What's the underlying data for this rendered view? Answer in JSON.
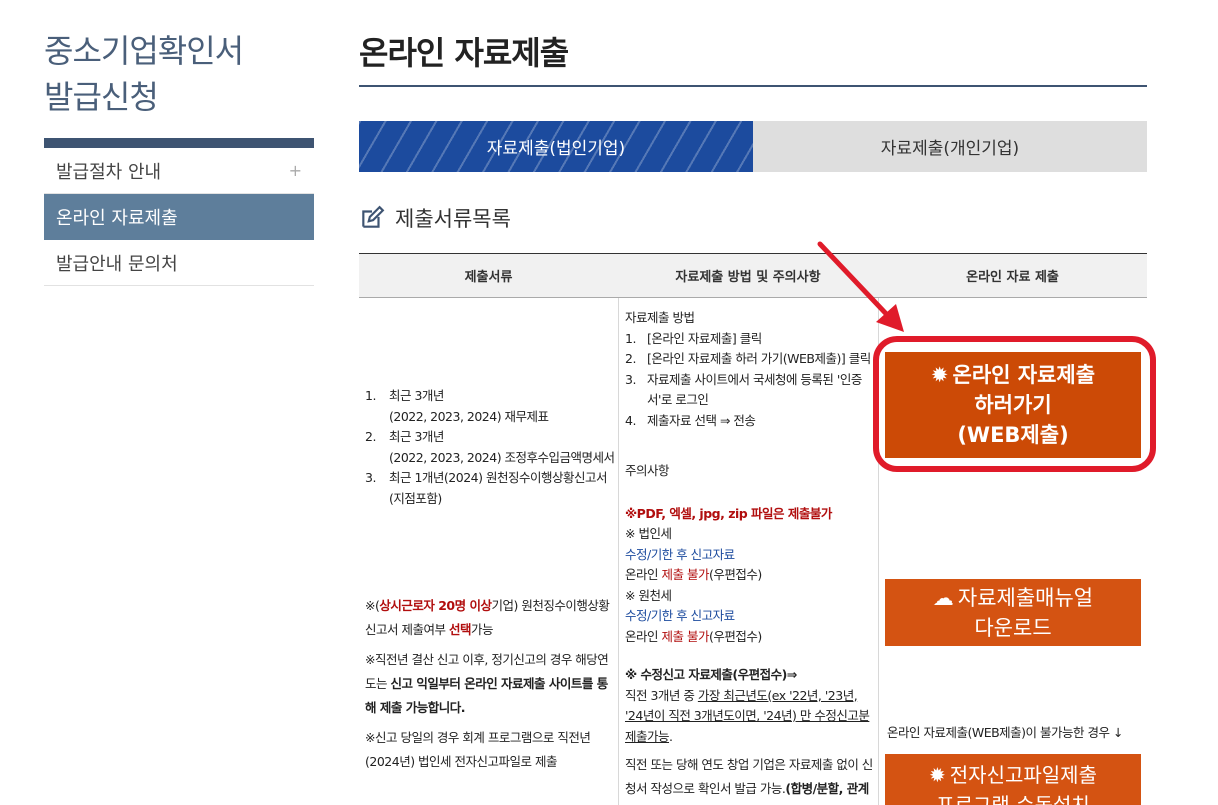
{
  "sidebar": {
    "title_line1": "중소기업확인서",
    "title_line2": "발급신청",
    "items": [
      {
        "label": "발급절차 안내",
        "plus": "+"
      },
      {
        "label": "온라인 자료제출"
      },
      {
        "label": "발급안내 문의처"
      }
    ]
  },
  "main": {
    "title": "온라인 자료제출",
    "tabs": [
      {
        "label": "자료제출(법인기업)"
      },
      {
        "label": "자료제출(개인기업)"
      }
    ],
    "section_title": "제출서류목록",
    "table": {
      "headers": [
        "제출서류",
        "자료제출 방법 및 주의사항",
        "온라인 자료 제출"
      ],
      "docs": [
        {
          "num": "1.",
          "line1": "최근 3개년",
          "line2": "(2022, 2023, 2024) 재무제표"
        },
        {
          "num": "2.",
          "line1": "최근 3개년",
          "line2": "(2022, 2023, 2024) 조정후수입금액명세서"
        },
        {
          "num": "3.",
          "line1": "최근 1개년(2024) 원천징수이행상황신고서",
          "line2": "(지점포함)"
        }
      ],
      "note1_pre": "※(",
      "note1_red": "상시근로자 20명 이상",
      "note1_mid": "기업) 원천징수이행상황신고서 제출여부 ",
      "note1_red2": "선택",
      "note1_post": "가능",
      "note2_pre": "※직전년 결산 신고 이후, 정기신고의 경우 해당연도는 ",
      "note2_bold": "신고 익일부터 온라인 자료제출 사이트를 통해 제출 가능합니다.",
      "note3": "※신고 당일의 경우 회계 프로그램으로 직전년(2024년) 법인세 전자신고파일로 제출",
      "method_title": "자료제출 방법",
      "steps": [
        {
          "num": "1.",
          "text": "[온라인 자료제출] 클릭"
        },
        {
          "num": "2.",
          "text": "[온라인 자료제출 하러 가기(WEB제출)] 클릭"
        },
        {
          "num": "3.",
          "text": "자료제출 사이트에서 국세청에 등록된 '인증서'로 로그인"
        },
        {
          "num": "4.",
          "text": "제출자료 선택 ⇒ 전송"
        }
      ],
      "caution_title": "주의사항",
      "caution_red": "※PDF, 엑셀, jpg, zip 파일은 제출불가",
      "corp_tax": "※ 법인세",
      "corp_amend": "수정/기한 후 신고자료",
      "corp_online_pre": "온라인 ",
      "corp_online_red": "제출 불가",
      "corp_online_post": "(우편접수)",
      "wh_tax": "※ 원천세",
      "wh_amend": "수정/기한 후 신고자료",
      "wh_online_pre": "온라인 ",
      "wh_online_red": "제출 불가",
      "wh_online_post": "(우편접수)",
      "amend_title": "※ 수정신고 자료제출(우편접수)⇒",
      "amend_text_pre": "직전 3개년 중 ",
      "amend_text_u": "가장 최근년도(ex '22년, '23년, '24년이 직전 3개년도이면, '24년) 만 수정신고분 제출가능",
      "amend_text_post": ".",
      "startup_pre": "직전 또는 당해 연도 창업 기업은 자료제출 없이 신청서 작성으로 확인서 발급 가능.",
      "startup_bold": "(합병/분할, 관계기업 보유기업, 소상공인 유예 검토 대상기업 등 제"
    },
    "buttons": {
      "web_line1": "온라인 자료제출",
      "web_line2": "하러가기",
      "web_line3": "(WEB제출)",
      "manual_line1": "자료제출매뉴얼",
      "manual_line2": "다운로드",
      "web_fail_note": "온라인 자료제출(WEB제출)이 불가능한 경우 ↓",
      "etax_line1": "전자신고파일제출",
      "etax_line2": "프로그램 수동설치"
    }
  },
  "colors": {
    "brand_navy": "#3e5472",
    "active_side": "#5e7e9b",
    "tab_blue": "#1c4b9e",
    "button_orange": "#cc4a06",
    "highlight_red": "#e01b2a",
    "text_red": "#b10e0e"
  }
}
